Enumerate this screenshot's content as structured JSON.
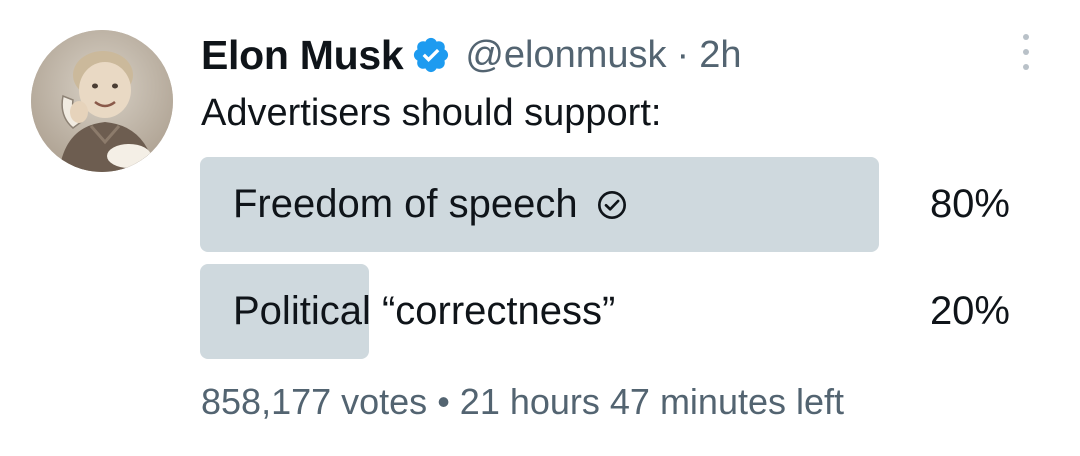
{
  "author": {
    "name": "Elon Musk",
    "verified_icon": "verified-badge-icon",
    "handle": "@elonmusk",
    "separator": "·",
    "time": "2h",
    "avatar": "avatar-photo"
  },
  "tweet": {
    "text": "Advertisers should support:"
  },
  "poll": {
    "options": [
      {
        "label": "Freedom of speech",
        "percent_text": "80%",
        "percent": 80,
        "selected": true,
        "selected_icon": "check-circle-icon"
      },
      {
        "label": "Political “correctness”",
        "percent_text": "20%",
        "percent": 20,
        "selected": false
      }
    ],
    "votes": "858,177 votes",
    "meta_separator": "•",
    "time_left": "21 hours 47 minutes left"
  },
  "menu": {
    "icon": "more-options-icon"
  },
  "colors": {
    "accent": "#1d9bf0",
    "poll_fill": "#cfd9de",
    "secondary_text": "#536471",
    "primary_text": "#0f1419"
  }
}
